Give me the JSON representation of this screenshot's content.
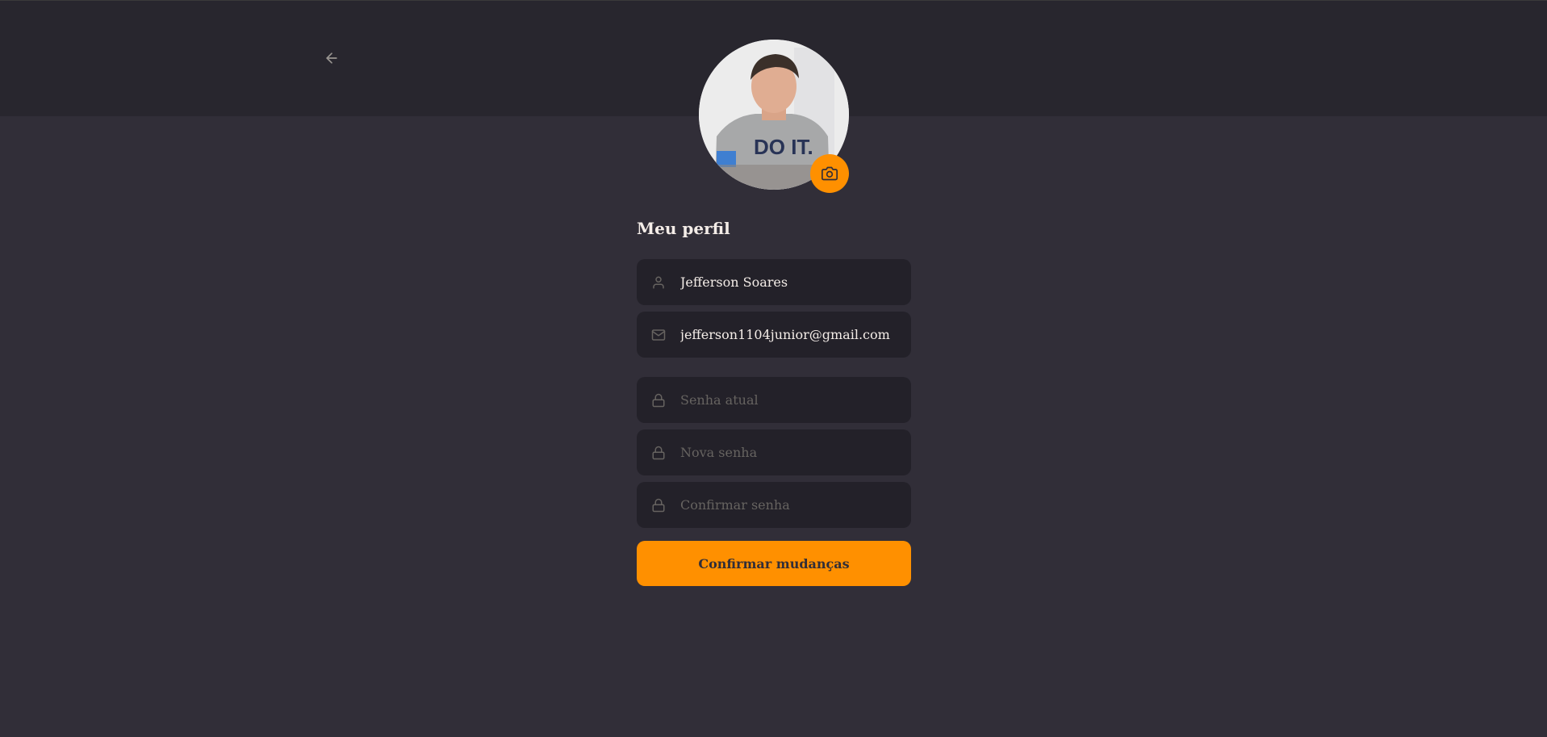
{
  "header": {
    "back_icon": "arrow-left-icon"
  },
  "profile": {
    "camera_icon": "camera-icon"
  },
  "form": {
    "title": "Meu perfil",
    "name": {
      "value": "Jefferson Soares",
      "icon": "user-icon"
    },
    "email": {
      "value": "jefferson1104junior@gmail.com",
      "icon": "mail-icon"
    },
    "old_password": {
      "placeholder": "Senha atual",
      "icon": "lock-icon"
    },
    "new_password": {
      "placeholder": "Nova senha",
      "icon": "lock-icon"
    },
    "confirm_password": {
      "placeholder": "Confirmar senha",
      "icon": "lock-icon"
    },
    "submit_label": "Confirmar mudanças"
  },
  "colors": {
    "background": "#312e38",
    "header": "#28262e",
    "input_bg": "#232129",
    "accent": "#ff9000",
    "text": "#f4ede8",
    "placeholder": "#666360"
  }
}
